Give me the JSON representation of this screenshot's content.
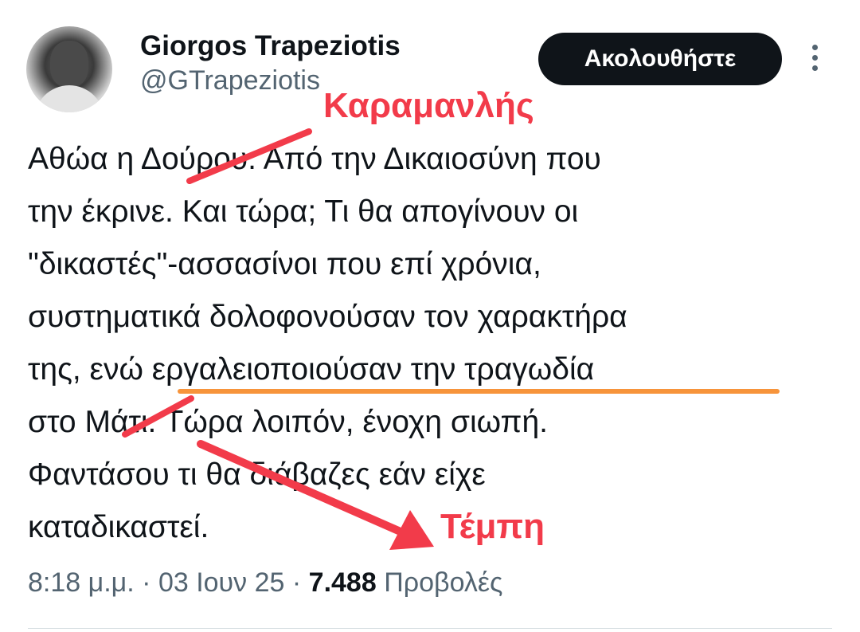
{
  "author": {
    "display_name": "Giorgos Trapeziotis",
    "handle": "@GTrapeziotis"
  },
  "follow_button": {
    "label": "Ακολουθήστε"
  },
  "more_icon": "vertical-ellipsis-icon",
  "tweet": {
    "lines": [
      "Αθώα η Δούρου. Από την Δικαιοσύνη που",
      "την έκρινε. Και τώρα; Τι θα απογίνουν οι",
      "\"δικαστές\"-ασσασίνοι που επί χρόνια,",
      "συστηματικά δολοφονούσαν τον χαρακτήρα",
      "της, ενώ εργαλειοποιούσαν την τραγωδία",
      "στο Μάτι. Τώρα λοιπόν, ένοχη σιωπή.",
      "Φαντάσου τι θα διάβαζες εάν είχε",
      "καταδικαστεί."
    ]
  },
  "annotations": {
    "karamanlis": "Καραμανλής",
    "tempi": "Τέμπη",
    "color": "#f23b4a",
    "underline_color": "#f7943b"
  },
  "meta": {
    "time": "8:18 μ.μ.",
    "separator": "·",
    "date": "03 Ιουν 25",
    "views_count": "7.488",
    "views_label": "Προβολές"
  },
  "colors": {
    "text": "#0f1419",
    "secondary_text": "#536471",
    "button_bg": "#0f1419",
    "button_text": "#ffffff"
  }
}
